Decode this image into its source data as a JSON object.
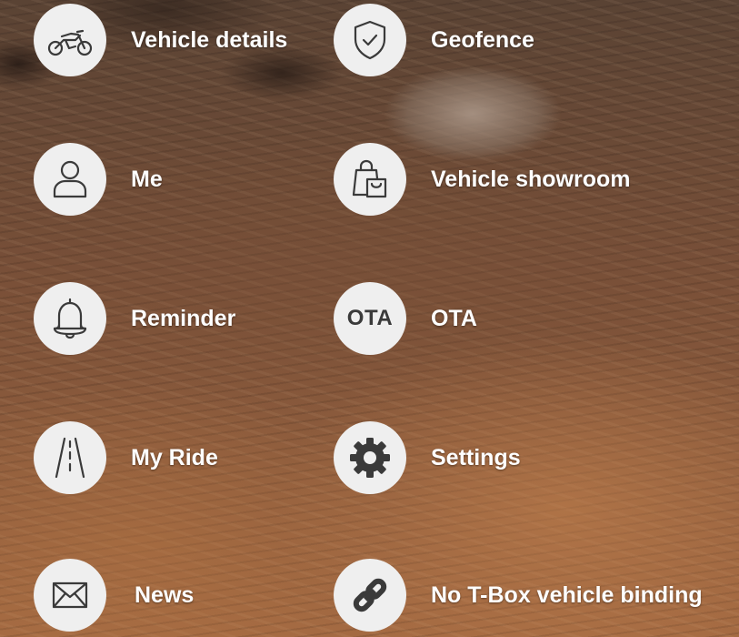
{
  "menu": {
    "vehicle_details": {
      "label": "Vehicle details",
      "icon": "motorcycle-icon"
    },
    "geofence": {
      "label": "Geofence",
      "icon": "shield-check-icon"
    },
    "me": {
      "label": "Me",
      "icon": "person-icon"
    },
    "vehicle_showroom": {
      "label": "Vehicle showroom",
      "icon": "shopping-bag-icon"
    },
    "reminder": {
      "label": "Reminder",
      "icon": "bell-icon"
    },
    "ota": {
      "label": "OTA",
      "icon_text": "OTA"
    },
    "my_ride": {
      "label": "My Ride",
      "icon": "road-icon"
    },
    "settings": {
      "label": "Settings",
      "icon": "gear-icon"
    },
    "news": {
      "label": "News",
      "icon": "envelope-icon"
    },
    "tbox_binding": {
      "label": "No T-Box vehicle binding",
      "icon": "link-icon"
    }
  },
  "colors": {
    "icon_background": "#efefef",
    "icon_stroke": "#3a3a3a",
    "label_text": "#ffffff"
  }
}
